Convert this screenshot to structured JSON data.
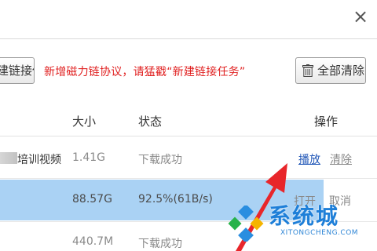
{
  "window": {
    "close_glyph": "×"
  },
  "toolbar": {
    "new_task_label": "新建链接任务",
    "notice": "新增磁力链协议，请猛戳“新建链接任务”",
    "clear_all_label": "全部清除"
  },
  "table": {
    "headers": {
      "size": "大小",
      "status": "状态",
      "actions": "操作"
    },
    "rows": [
      {
        "name": "培训视频",
        "size": "1.41G",
        "status": "下载成功",
        "action1": "播放",
        "action2": "清除"
      },
      {
        "name": "",
        "size": "88.57G",
        "status": "92.5%(61B/s)",
        "action1": "打开",
        "action2": "取消"
      },
      {
        "name": "",
        "size": "440.7M",
        "status": "下载成功",
        "action1": "",
        "action2": ""
      }
    ]
  },
  "watermark": {
    "text": "系统城",
    "url": "XITONGCHENG.COM"
  },
  "colors": {
    "notice": "#e02020",
    "selected_row": "#aad2f4",
    "link": "#2459b8",
    "arrow": "#e8262b",
    "watermark": "#1e7fd8"
  }
}
